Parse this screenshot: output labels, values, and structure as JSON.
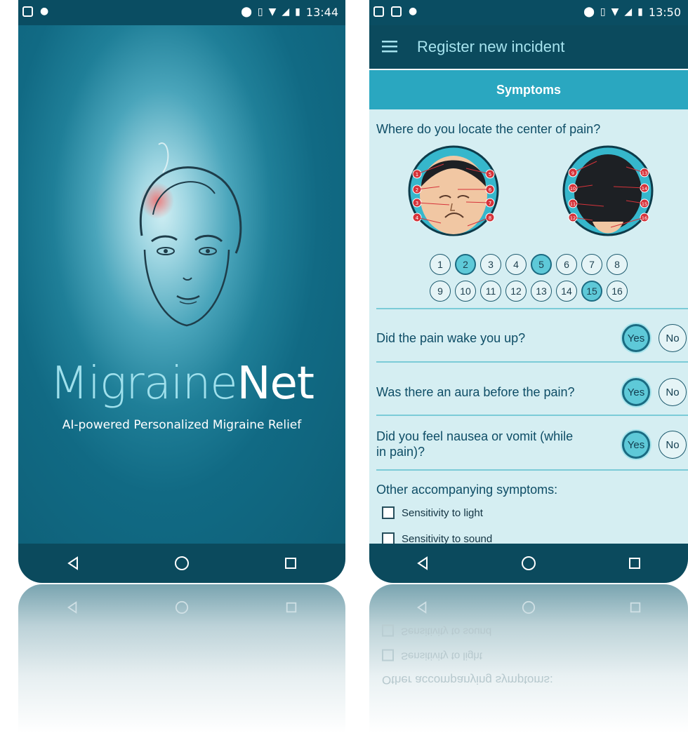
{
  "splash": {
    "status_time": "13:44",
    "brand_part1": "Migraine",
    "brand_part2": "Net",
    "tagline": "AI-powered Personalized Migraine Relief"
  },
  "app": {
    "status_time": "13:50",
    "title": "Register new incident",
    "section": "Symptoms",
    "pain_question": "Where do you locate the center of pain?",
    "pain_points_row1": [
      "1",
      "2",
      "3",
      "4",
      "5",
      "6",
      "7",
      "8"
    ],
    "pain_points_row2": [
      "9",
      "10",
      "11",
      "12",
      "13",
      "14",
      "15",
      "16"
    ],
    "selected_points": [
      "2",
      "5",
      "15"
    ],
    "questions": [
      {
        "text": "Did the pain wake you up?",
        "yes": "Yes",
        "no": "No",
        "selected": "Yes"
      },
      {
        "text": "Was there an aura before the pain?",
        "yes": "Yes",
        "no": "No",
        "selected": "Yes"
      },
      {
        "text": "Did you feel nausea or vomit (while",
        "text2": "in pain)?",
        "yes": "Yes",
        "no": "No",
        "selected": "Yes"
      }
    ],
    "other_symptoms_label": "Other accompanying symptoms:",
    "checkboxes": [
      {
        "label": "Sensitivity to light",
        "checked": false
      },
      {
        "label": "Sensitivity to sound",
        "checked": false
      }
    ]
  },
  "colors": {
    "dark_teal": "#0b4a5d",
    "accent": "#2aa7c0",
    "selected": "#5ec9d8",
    "content_bg": "#d5eef2"
  }
}
